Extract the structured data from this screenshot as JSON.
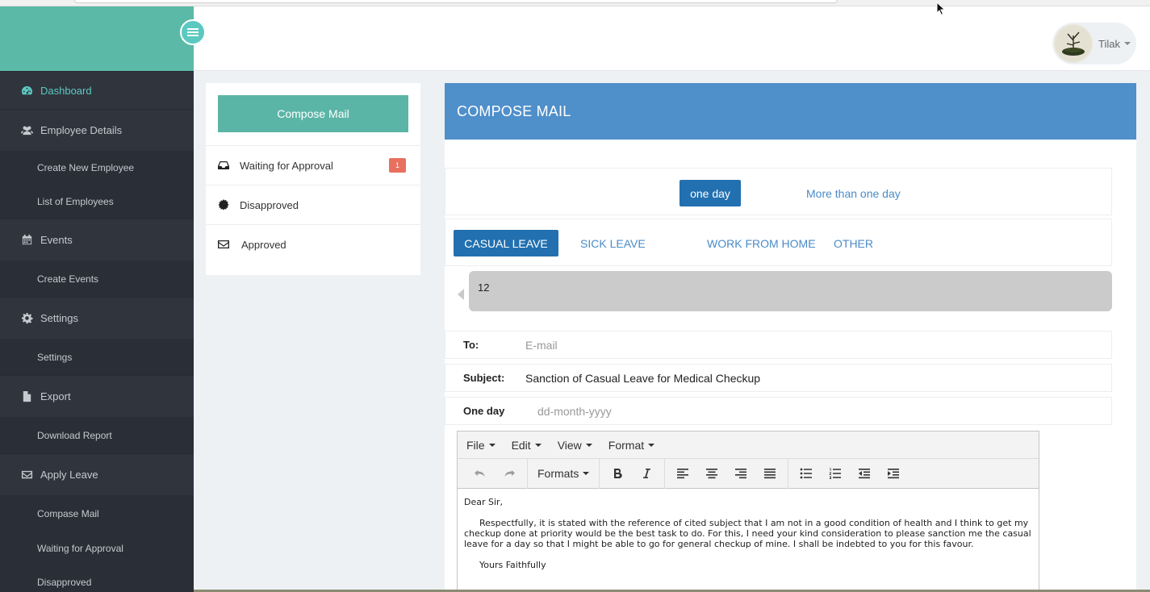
{
  "sidebar": {
    "sections": [
      {
        "label": "Dashboard",
        "icon": "dashboard-icon",
        "active": true,
        "items": []
      },
      {
        "label": "Employee Details",
        "icon": "users-icon",
        "items": [
          "Create New Employee",
          "List of Employees"
        ]
      },
      {
        "label": "Events",
        "icon": "calendar-icon",
        "items": [
          "Create Events"
        ]
      },
      {
        "label": "Settings",
        "icon": "gear-icon",
        "items": [
          "Settings"
        ]
      },
      {
        "label": "Export",
        "icon": "file-icon",
        "items": [
          "Download Report"
        ]
      },
      {
        "label": "Apply Leave",
        "icon": "envelope-icon",
        "items": [
          "Compase Mail",
          "Waiting for Approval",
          "Disapproved"
        ]
      }
    ]
  },
  "header": {
    "user_name": "Tilak"
  },
  "mail_panel": {
    "compose_label": "Compose Mail",
    "folders": [
      {
        "label": "Waiting for Approval",
        "icon": "inbox-icon",
        "badge": "1"
      },
      {
        "label": "Disapproved",
        "icon": "certificate-icon"
      },
      {
        "label": "Approved",
        "icon": "envelope-icon"
      }
    ]
  },
  "compose": {
    "title": "COMPOSE MAIL",
    "duration_options": {
      "selected": "one day",
      "other": "More than one day"
    },
    "leave_types": [
      "CASUAL LEAVE",
      "SICK LEAVE",
      "WORK FROM HOME",
      "OTHER"
    ],
    "selected_leave": "CASUAL LEAVE",
    "leave_count": "12",
    "to": {
      "label": "To:",
      "value": "",
      "placeholder": "E-mail"
    },
    "subject": {
      "label": "Subject:",
      "value": "Sanction of Casual Leave for Medical Checkup"
    },
    "one_day": {
      "label": "One day",
      "value": "",
      "placeholder": "dd-month-yyyy"
    },
    "editor": {
      "menus": [
        "File",
        "Edit",
        "View",
        "Format"
      ],
      "formats_label": "Formats",
      "greeting": "Dear Sir,",
      "body": "Respectfully, it is stated with the reference of cited subject that I am not in a good condition of health and I think to get my checkup done at priority would be the best task to do. For this, I need your kind consideration to please sanction me the casual leave for a day so that I might be able to go for general checkup of mine. I shall be indebted to you for this favour.",
      "closing": "Yours Faithfully"
    }
  },
  "colors": {
    "brand": "#5bb9a7",
    "sidebar": "#2a2e36",
    "header_blue": "#4f8fca",
    "active_pill": "#2270b0",
    "link": "#4a8bc7",
    "badge": "#e8705f"
  }
}
